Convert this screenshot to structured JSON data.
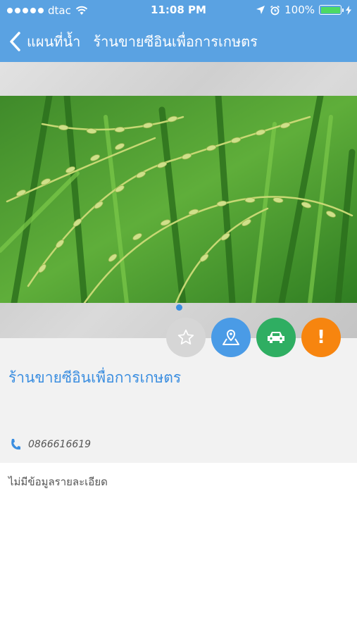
{
  "status_bar": {
    "carrier": "dtac",
    "time": "11:08 PM",
    "battery": "100%",
    "battery_level": 1.0
  },
  "nav": {
    "back_label": "แผนที่น้ำ",
    "title": "ร้านขายซีอินเพื่อการเกษตร"
  },
  "shop": {
    "name": "ร้านขายซีอินเพื่อการเกษตร",
    "phone": "0866616619",
    "details": "ไม่มีข้อมูลรายละเอียด"
  },
  "actions": [
    {
      "icon": "star-outline-icon",
      "color": "#d6d6d6"
    },
    {
      "icon": "map-pin-icon",
      "color": "#4a9be6"
    },
    {
      "icon": "car-icon",
      "color": "#2fae62"
    },
    {
      "icon": "exclamation-icon",
      "color": "#f7850f",
      "glyph": "!"
    }
  ],
  "colors": {
    "header": "#5aa2e2",
    "accent": "#3b8ee0",
    "info_background": "#f2f2f2"
  }
}
